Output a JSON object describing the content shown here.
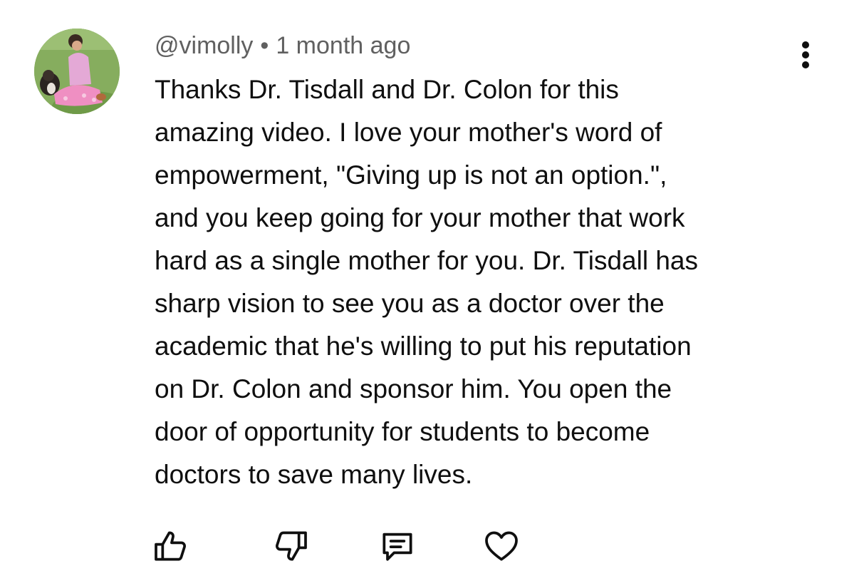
{
  "comment": {
    "author": "@vimolly",
    "separator": "•",
    "time": "1 month ago",
    "text": "Thanks Dr. Tisdall and Dr. Colon for this\namazing video.  I love your mother's word of\nempowerment, \"Giving up is not an option.\",\nand you keep going for your mother that work\nhard as a single mother for you.  Dr. Tisdall has\nsharp vision to see you as a doctor over the\nacademic that he's willing to put his reputation\non Dr. Colon and sponsor him.  You open the\ndoor of opportunity for students to become\ndoctors to save many lives."
  },
  "icons": {
    "avatar": "avatar-photo",
    "more": "more-vert-icon",
    "like": "thumbs-up-icon",
    "dislike": "thumbs-down-icon",
    "reply": "reply-comment-icon",
    "heart": "heart-icon"
  },
  "colors": {
    "text": "#0f0f0f",
    "meta": "#606060",
    "background": "#ffffff"
  }
}
